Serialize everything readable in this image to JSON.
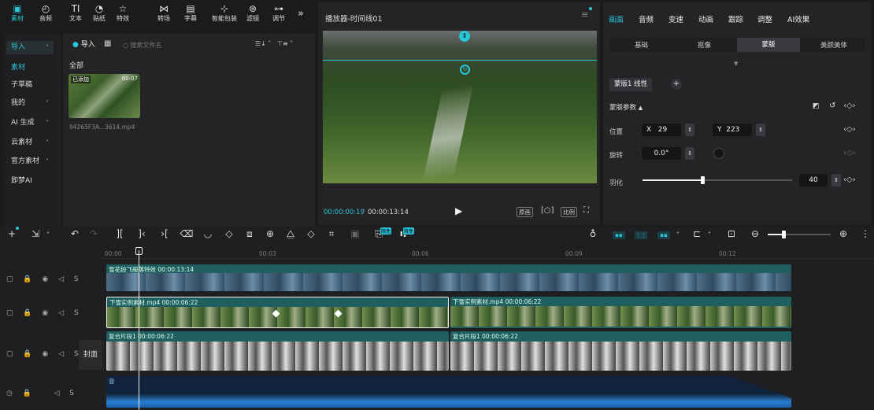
{
  "toolbar": {
    "items": [
      {
        "label": "素材",
        "icon": "media-icon"
      },
      {
        "label": "音频",
        "icon": "audio-icon"
      },
      {
        "label": "文本",
        "icon": "text-icon"
      },
      {
        "label": "贴纸",
        "icon": "sticker-icon"
      },
      {
        "label": "特效",
        "icon": "effects-icon"
      },
      {
        "label": "转场",
        "icon": "transition-icon"
      },
      {
        "label": "字幕",
        "icon": "subtitle-icon"
      },
      {
        "label": "智能包装",
        "icon": "smart-pack-icon"
      },
      {
        "label": "滤镜",
        "icon": "filter-icon"
      },
      {
        "label": "调节",
        "icon": "adjust-icon"
      }
    ],
    "more": "»"
  },
  "sidebar": {
    "items": [
      {
        "label": "导入",
        "active": true
      },
      {
        "label": "素材",
        "active": false,
        "highlight": true
      },
      {
        "label": "子草稿"
      },
      {
        "label": "我的"
      },
      {
        "label": "AI 生成"
      },
      {
        "label": "云素材"
      },
      {
        "label": "官方素材"
      },
      {
        "label": "即梦AI"
      }
    ]
  },
  "media": {
    "import_label": "导入",
    "search_placeholder": "搜索文件名",
    "section": "全部",
    "thumb_badge": "已添加",
    "thumb_duration": "00:07",
    "filename": "94265F3A...3614.mp4"
  },
  "player": {
    "title": "播放器-时间线01",
    "current_time": "00:00:00:19",
    "total_time": "00:00:13:14",
    "btn_original": "原画",
    "btn_ratio": "比例"
  },
  "inspector": {
    "tabs": [
      "画面",
      "音频",
      "变速",
      "动画",
      "跟踪",
      "调整",
      "AI效果"
    ],
    "subtabs": [
      "基础",
      "抠像",
      "蒙版",
      "美颜美体"
    ],
    "mask_name": "蒙版1 线性",
    "mask_params": "蒙版参数",
    "position_label": "位置",
    "x_label": "X",
    "x_value": "29",
    "y_label": "Y",
    "y_value": "223",
    "rotate_label": "旋转",
    "rotate_value": "0.0°",
    "feather_label": "羽化",
    "feather_value": "40",
    "feather_fraction": 0.4
  },
  "timeline": {
    "ticks": [
      "00:00",
      "00:03",
      "00:06",
      "00:09",
      "00:12"
    ],
    "cover_label": "封面",
    "track_ctrl": "S",
    "clips": {
      "snow_fx": "雪花纷飞般落特效  00:00:13:14",
      "clip1": "下雪实例素材.mp4  00:00:06:22",
      "clip2": "下雪实例素材.mp4  00:00:06:22",
      "comp1": "复合片段1  00:00:06:22",
      "comp2": "复合片段1  00:00:06:22",
      "audio": "音"
    },
    "badge_new": "限免"
  },
  "colors": {
    "accent": "#29c5d8",
    "clip": "#1f5f60",
    "audio": "#1b4a78",
    "bg": "#1b1b1d"
  }
}
